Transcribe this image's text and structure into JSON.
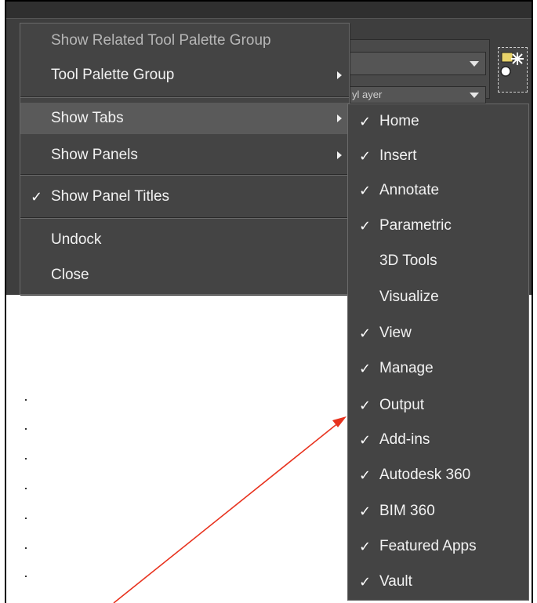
{
  "background": {
    "dropdown_text": "yl ayer"
  },
  "context_menu": {
    "items": [
      {
        "label": "Show Related Tool Palette Group",
        "checked": false,
        "submenu": false,
        "disabled": true
      },
      {
        "label": "Tool Palette Group",
        "checked": false,
        "submenu": true,
        "disabled": false
      },
      {
        "label": "Show Tabs",
        "checked": false,
        "submenu": true,
        "disabled": false,
        "active": true
      },
      {
        "label": "Show Panels",
        "checked": false,
        "submenu": true,
        "disabled": false
      },
      {
        "label": "Show Panel Titles",
        "checked": true,
        "submenu": false,
        "disabled": false
      },
      {
        "label": "Undock",
        "checked": false,
        "submenu": false,
        "disabled": false
      },
      {
        "label": "Close",
        "checked": false,
        "submenu": false,
        "disabled": false
      }
    ]
  },
  "tabs_submenu": {
    "items": [
      {
        "label": "Home",
        "checked": true
      },
      {
        "label": "Insert",
        "checked": true
      },
      {
        "label": "Annotate",
        "checked": true
      },
      {
        "label": "Parametric",
        "checked": true
      },
      {
        "label": "3D Tools",
        "checked": false
      },
      {
        "label": "Visualize",
        "checked": false
      },
      {
        "label": "View",
        "checked": true
      },
      {
        "label": "Manage",
        "checked": true
      },
      {
        "label": "Output",
        "checked": true
      },
      {
        "label": "Add-ins",
        "checked": true
      },
      {
        "label": "Autodesk 360",
        "checked": true
      },
      {
        "label": "BIM 360",
        "checked": true
      },
      {
        "label": "Featured Apps",
        "checked": true
      },
      {
        "label": "Vault",
        "checked": true
      }
    ]
  },
  "check_glyph": "✓",
  "colors": {
    "menu_bg": "#444444",
    "annotation_arrow": "#e8321e"
  }
}
